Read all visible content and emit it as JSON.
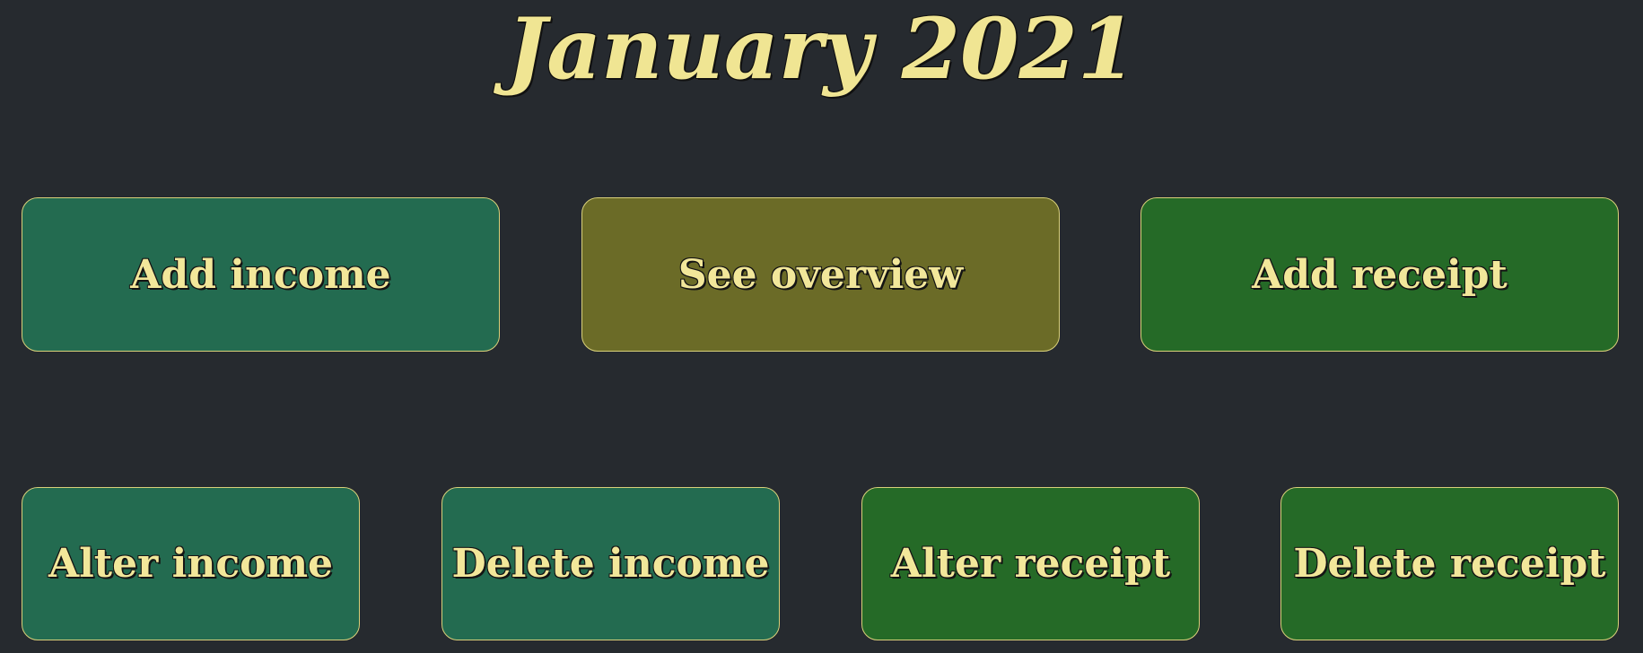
{
  "header": {
    "title": "January 2021"
  },
  "actions": {
    "add_income": "Add income",
    "see_overview": "See overview",
    "add_receipt": "Add receipt",
    "alter_income": "Alter income",
    "delete_income": "Delete income",
    "alter_receipt": "Alter receipt",
    "delete_receipt": "Delete receipt"
  },
  "colors": {
    "background": "#262a2f",
    "text": "#f2e79a",
    "income_button": "#236b50",
    "overview_button": "#6b6b27",
    "receipt_button": "#256a27",
    "button_border": "#d9d07a"
  }
}
